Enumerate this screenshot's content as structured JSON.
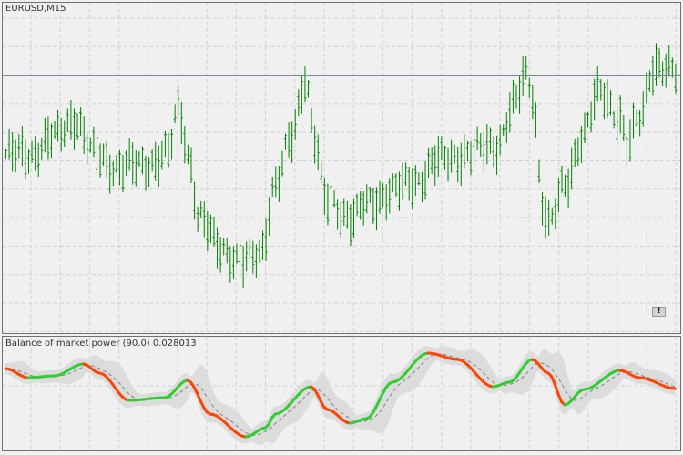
{
  "main_panel": {
    "symbol_label": "EURUSD,M15",
    "alert_button": "!"
  },
  "indicator_panel": {
    "title": "Balance of market power (90.0) 0.028013"
  },
  "colors": {
    "background": "#f0f0f0",
    "grid": "#d0d0d0",
    "bars": "#008000",
    "price_line": "#778899",
    "up": "#32cd32",
    "down": "#ff4500",
    "band": "#dcdcdc",
    "signal": "#808080"
  },
  "chart_data": [
    {
      "type": "bar",
      "title": "EURUSD,M15",
      "bar_count": 207,
      "price_level_keypoints": [
        [
          1,
          54
        ],
        [
          7,
          54
        ],
        [
          15,
          59
        ],
        [
          21,
          65
        ],
        [
          27,
          54
        ],
        [
          35,
          50
        ],
        [
          43,
          51
        ],
        [
          50,
          54
        ],
        [
          53,
          68
        ],
        [
          57,
          51
        ],
        [
          59,
          35
        ],
        [
          66,
          26
        ],
        [
          73,
          21
        ],
        [
          78,
          24
        ],
        [
          83,
          45
        ],
        [
          88,
          59
        ],
        [
          92,
          78
        ],
        [
          95,
          59
        ],
        [
          98,
          40
        ],
        [
          107,
          35
        ],
        [
          111,
          39
        ],
        [
          119,
          43
        ],
        [
          126,
          46
        ],
        [
          133,
          52
        ],
        [
          141,
          54
        ],
        [
          151,
          57
        ],
        [
          156,
          68
        ],
        [
          160,
          78
        ],
        [
          162,
          73
        ],
        [
          165,
          40
        ],
        [
          167,
          32
        ],
        [
          172,
          45
        ],
        [
          177,
          59
        ],
        [
          183,
          73
        ],
        [
          189,
          65
        ],
        [
          191,
          56
        ],
        [
          195,
          65
        ],
        [
          199,
          81
        ],
        [
          206,
          78
        ]
      ],
      "current_price_level": 78,
      "ylim": [
        0,
        100
      ]
    },
    {
      "type": "line",
      "title": "Balance of market power (90.0)",
      "last_value": 0.028013,
      "keypoints": [
        [
          0,
          0.035
        ],
        [
          7,
          0.025
        ],
        [
          15,
          0.027
        ],
        [
          24,
          0.04
        ],
        [
          29,
          0.03
        ],
        [
          38,
          0.0
        ],
        [
          49,
          0.003
        ],
        [
          56,
          0.022
        ],
        [
          63,
          -0.015
        ],
        [
          74,
          -0.04
        ],
        [
          80,
          -0.03
        ],
        [
          83,
          -0.015
        ],
        [
          94,
          0.015
        ],
        [
          99,
          -0.01
        ],
        [
          106,
          -0.025
        ],
        [
          111,
          -0.02
        ],
        [
          119,
          0.02
        ],
        [
          130,
          0.052
        ],
        [
          139,
          0.045
        ],
        [
          150,
          0.015
        ],
        [
          155,
          0.02
        ],
        [
          162,
          0.045
        ],
        [
          167,
          0.03
        ],
        [
          172,
          -0.005
        ],
        [
          178,
          0.012
        ],
        [
          189,
          0.033
        ],
        [
          195,
          0.025
        ],
        [
          206,
          0.013
        ]
      ],
      "ylim": [
        -0.056,
        0.07
      ]
    }
  ]
}
